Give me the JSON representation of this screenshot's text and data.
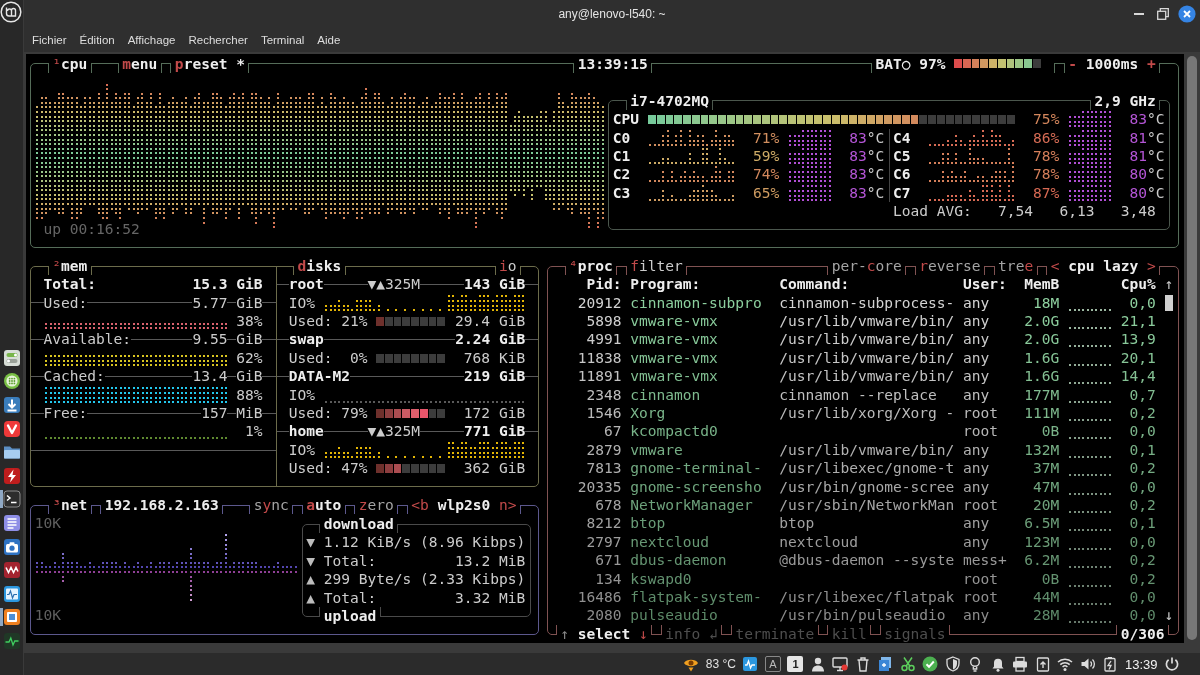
{
  "window": {
    "title": "any@lenovo-l540: ~"
  },
  "menu_bar": [
    "Fichier",
    "Édition",
    "Affichage",
    "Rechercher",
    "Terminal",
    "Aide"
  ],
  "dock": [
    {
      "running": false
    },
    {
      "running": false
    },
    {
      "running": false
    },
    {
      "running": false
    },
    {
      "running": false
    },
    {
      "running": false
    },
    {
      "running": true
    },
    {
      "running": false
    },
    {
      "running": false
    },
    {
      "running": false
    },
    {
      "running": false
    },
    {
      "running": true
    },
    {
      "running": false
    }
  ],
  "cpu_box": {
    "title": {
      "number": "¹",
      "label": "cpu"
    },
    "options": [
      {
        "key": "m",
        "post": "enu"
      },
      {
        "key": "p",
        "post": "reset *"
      }
    ],
    "clock": "13:39:15",
    "battery": {
      "label": "BAT○ 97%",
      "level": 0.9
    },
    "update": {
      "decrease": "-",
      "interval": "1000ms",
      "increase": "+"
    },
    "uptime": "up 00:16:52",
    "cpu_name": "i7-4702MQ",
    "frequency": "2,9 GHz",
    "total": {
      "name": "CPU",
      "level": 0.74,
      "percent": "75%",
      "color": "#d3865c",
      "temp": "83",
      "unit": "°C"
    },
    "cores": [
      {
        "name": "C0",
        "percent": "71%",
        "color": "#d28f5f",
        "temp": "83",
        "unit": "°C"
      },
      {
        "name": "C1",
        "percent": "59%",
        "color": "#ceab66",
        "temp": "83",
        "unit": "°C"
      },
      {
        "name": "C2",
        "percent": "74%",
        "color": "#d3885d",
        "temp": "83",
        "unit": "°C"
      },
      {
        "name": "C3",
        "percent": "65%",
        "color": "#d09d62",
        "temp": "83",
        "unit": "°C"
      },
      {
        "name": "C4",
        "percent": "86%",
        "color": "#d76c55",
        "temp": "81",
        "unit": "°C"
      },
      {
        "name": "C5",
        "percent": "78%",
        "color": "#d57f5a",
        "temp": "81",
        "unit": "°C"
      },
      {
        "name": "C6",
        "percent": "78%",
        "color": "#d57f5a",
        "temp": "80",
        "unit": "°C"
      },
      {
        "name": "C7",
        "percent": "87%",
        "color": "#d86a54",
        "temp": "80",
        "unit": "°C"
      }
    ],
    "load": {
      "label": "Load AVG:",
      "values": [
        "7,54",
        "6,13",
        "3,48"
      ]
    }
  },
  "mem_box": {
    "title": {
      "number": "²",
      "label": "mem"
    },
    "rows": [
      {
        "kind": "total",
        "label": "Total:",
        "value": "15.3 GiB"
      },
      {
        "kind": "meter",
        "label": "Used:",
        "value": "5.77",
        "unit": "GiB",
        "percent": "38%",
        "color": "#d9626d"
      },
      {
        "kind": "meter",
        "label": "Available:",
        "value": "9.55",
        "unit": "GiB",
        "percent": "62%",
        "color": "#d8c420"
      },
      {
        "kind": "meter",
        "label": "Cached:",
        "value": "13.4",
        "unit": "GiB",
        "percent": "88%",
        "color": "#22c8ee"
      },
      {
        "kind": "meter",
        "label": "Free:",
        "value": "157",
        "unit": "MiB",
        "percent": "1%",
        "color": "#5f8a30"
      }
    ]
  },
  "disks": {
    "title": {
      "key": "d",
      "post": "isks"
    },
    "io_toggle": {
      "key": "i",
      "post": "o"
    },
    "items": [
      {
        "kind": "disk",
        "name": "root",
        "io": "▼▲325M",
        "total": "143 GiB",
        "io_label": "IO%",
        "io_active": true,
        "used_label": "Used:",
        "percent": "21%",
        "level": 0.125,
        "used": "29.4 GiB"
      },
      {
        "kind": "swap",
        "name": "swap",
        "total": "2.24 GiB",
        "used_label": "Used:",
        "percent": "0%",
        "used": "768 KiB"
      },
      {
        "kind": "disk",
        "name": "DATA-M2",
        "total": "219 GiB",
        "io_label": "IO%",
        "io_active": false,
        "used_label": "Used:",
        "percent": "79%",
        "level": 0.75,
        "used": "172 GiB"
      },
      {
        "kind": "disk",
        "name": "home",
        "io": "▼▲325M",
        "total": "771 GiB",
        "io_label": "IO%",
        "io_active": true,
        "used_label": "Used:",
        "percent": "47%",
        "level": 0.375,
        "used": "362 GiB"
      }
    ]
  },
  "net_box": {
    "title": {
      "number": "³",
      "label": "net"
    },
    "address": "192.168.2.163",
    "toggles": [
      {
        "pre": "s",
        "key": "y",
        "post": "nc",
        "on": false
      },
      {
        "key": "a",
        "post": "uto",
        "on": true
      },
      {
        "key": "z",
        "post": "ero",
        "on": false
      }
    ],
    "interface": {
      "prev": "<b",
      "name": "wlp2s0",
      "next": "n>"
    },
    "scale_top": "10K",
    "scale_bottom": "10K",
    "download": {
      "title": "download",
      "rate": {
        "arrow": "▼",
        "text": "1.12 KiB/s (8.96 Kibps)"
      },
      "total": {
        "arrow": "▼",
        "label": "Total:",
        "value": "13.2 MiB"
      }
    },
    "upload": {
      "title": "upload",
      "rate": {
        "arrow": "▲",
        "text": "299 Byte/s (2.33 Kibps)"
      },
      "total": {
        "arrow": "▲",
        "label": "Total:",
        "value": "3.32 MiB"
      }
    }
  },
  "proc_box": {
    "title": {
      "number": "⁴",
      "label": "proc"
    },
    "filter": {
      "key": "f",
      "post": "ilter"
    },
    "toggles": [
      {
        "pre": "per-",
        "key": "c",
        "post": "ore",
        "on": false
      },
      {
        "key": "r",
        "post": "everse",
        "on": false
      },
      {
        "pre": "tre",
        "key": "e",
        "on": false
      }
    ],
    "sorting": {
      "prev": "<",
      "name": "cpu lazy",
      "next": ">"
    },
    "columns": [
      "Pid:",
      "Program:",
      "Command:",
      "User:",
      "MemB",
      "Cpu%"
    ],
    "rows": [
      {
        "pid": "20912",
        "program": "cinnamon-subpro",
        "command": "cinnamon-subprocess-",
        "user": "any",
        "mem": "18M",
        "cpu": "0,0"
      },
      {
        "pid": "5898",
        "program": "vmware-vmx",
        "command": "/usr/lib/vmware/bin/",
        "user": "any",
        "mem": "2.0G",
        "cpu": "21,1"
      },
      {
        "pid": "4991",
        "program": "vmware-vmx",
        "command": "/usr/lib/vmware/bin/",
        "user": "any",
        "mem": "2.0G",
        "cpu": "13,9"
      },
      {
        "pid": "11838",
        "program": "vmware-vmx",
        "command": "/usr/lib/vmware/bin/",
        "user": "any",
        "mem": "1.6G",
        "cpu": "20,1"
      },
      {
        "pid": "11891",
        "program": "vmware-vmx",
        "command": "/usr/lib/vmware/bin/",
        "user": "any",
        "mem": "1.6G",
        "cpu": "14,4"
      },
      {
        "pid": "2348",
        "program": "cinnamon",
        "command": "cinnamon --replace",
        "user": "any",
        "mem": "177M",
        "cpu": "0,7"
      },
      {
        "pid": "1546",
        "program": "Xorg",
        "command": "/usr/lib/xorg/Xorg -",
        "user": "root",
        "mem": "111M",
        "cpu": "0,2"
      },
      {
        "pid": "67",
        "program": "kcompactd0",
        "user": "root",
        "mem": "0B",
        "cpu": "0,0"
      },
      {
        "pid": "2879",
        "program": "vmware",
        "command": "/usr/lib/vmware/bin/",
        "user": "any",
        "mem": "132M",
        "cpu": "0,1"
      },
      {
        "pid": "7813",
        "program": "gnome-terminal-",
        "command": "/usr/libexec/gnome-t",
        "user": "any",
        "mem": "37M",
        "cpu": "0,2"
      },
      {
        "pid": "20335",
        "program": "gnome-screensho",
        "command": "/usr/bin/gnome-scree",
        "user": "any",
        "mem": "47M",
        "cpu": "0,0"
      },
      {
        "pid": "678",
        "program": "NetworkManager",
        "command": "/usr/sbin/NetworkMan",
        "user": "root",
        "mem": "20M",
        "cpu": "0,2"
      },
      {
        "pid": "8212",
        "program": "btop",
        "command": "btop",
        "user": "any",
        "mem": "6.5M",
        "cpu": "0,1"
      },
      {
        "pid": "2797",
        "program": "nextcloud",
        "command": "nextcloud",
        "user": "any",
        "mem": "123M",
        "cpu": "0,0"
      },
      {
        "pid": "671",
        "program": "dbus-daemon",
        "command": "@dbus-daemon --syste",
        "user": "mess+",
        "mem": "6.2M",
        "cpu": "0,2"
      },
      {
        "pid": "134",
        "program": "kswapd0",
        "user": "root",
        "mem": "0B",
        "cpu": "0,2"
      },
      {
        "pid": "16486",
        "program": "flatpak-system-",
        "command": "/usr/libexec/flatpak",
        "user": "root",
        "mem": "44M",
        "cpu": "0,0"
      },
      {
        "pid": "2080",
        "program": "pulseaudio",
        "command": "/usr/bin/pulseaudio",
        "user": "any",
        "mem": "28M",
        "cpu": "0,0"
      }
    ],
    "scroll": {
      "up": "↑",
      "down": "↓"
    },
    "footer": [
      {
        "pre": "↑",
        "label": "select",
        "post": "↓",
        "disabled": false
      },
      {
        "label": "info",
        "post": "↲",
        "disabled": true
      },
      {
        "label": "terminate",
        "disabled": true
      },
      {
        "label": "kill",
        "disabled": true
      },
      {
        "label": "signals",
        "disabled": true
      }
    ],
    "count": "0/306"
  },
  "taskbar": {
    "temperature": "83 °C",
    "keyboard": "A",
    "workspace": "1",
    "clock": "13:39"
  }
}
